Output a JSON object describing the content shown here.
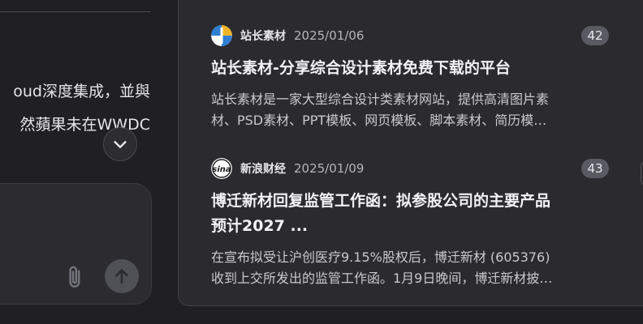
{
  "chat": {
    "line1": "oud深度集成，並與",
    "line2": "然蘋果未在WWDC"
  },
  "composer": {
    "attach_icon": "paperclip-icon",
    "send_icon": "arrow-up-icon"
  },
  "news": [
    {
      "source": "站长素材",
      "date": "2025/01/06",
      "count": "42",
      "title": "站长素材-分享综合设计素材免费下载的平台",
      "snippet_line1": "站长素材是一家大型综合设计类素材网站，提供高清图片素",
      "snippet_line2": "材、PSD素材、PPT模板、网页模板、脚本素材、简历模…",
      "logo_icon": "zhanzhang-logo-icon"
    },
    {
      "source": "新浪财经",
      "date": "2025/01/09",
      "count": "43",
      "title_line1": "博迁新材回复监管工作函：拟参股公司的主要产品",
      "title_line2": "预计2027 ...",
      "snippet_line1": "在宣布拟受让沪创医疗9.15%股权后，博迁新材 (605376)",
      "snippet_line2": "收到上交所发出的监管工作函。1月9日晚间，博迁新材披…",
      "logo_icon": "sina-logo-icon"
    }
  ],
  "colors": {
    "background": "#202024",
    "panel": "#2a2a2f",
    "badge": "#5a5a62"
  }
}
